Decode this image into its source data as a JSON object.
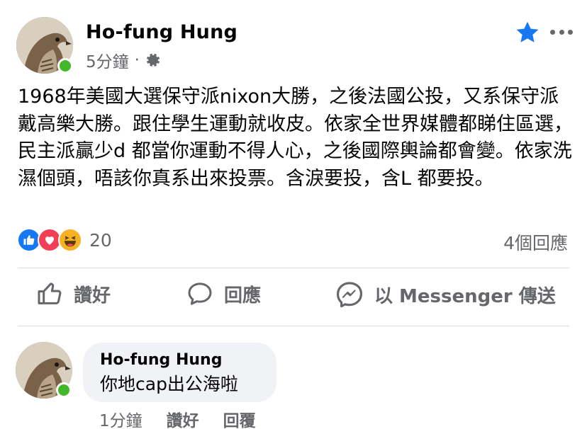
{
  "post": {
    "author": "Ho-fung Hung",
    "time": "5分鐘",
    "separator": "·",
    "privacy_icon": "gear-icon",
    "text": "1968年美國大選保守派nixon大勝，之後法國公投，又系保守派戴高樂大勝。跟住學生運動就收皮。依家全世界媒體都睇住區選，民主派贏少d 都當你運動不得人心，之後國際輿論都會變。依家洗濕個頭，唔該你真系出來投票。含淚要投，含L 都要投。",
    "reaction_count": "20",
    "reactions": [
      "like",
      "love",
      "haha"
    ],
    "comment_count": "4個回應"
  },
  "actions": {
    "like_label": "讚好",
    "comment_label": "回應",
    "share_label": "以 Messenger 傳送"
  },
  "comment": {
    "author": "Ho-fung Hung",
    "text": "你地cap出公海啦",
    "time": "1分鐘",
    "like_label": "讚好",
    "reply_label": "回覆"
  },
  "colors": {
    "accent": "#1877f2",
    "online": "#42b72a",
    "secondary_text": "#65676b",
    "bubble": "#f0f2f5"
  }
}
